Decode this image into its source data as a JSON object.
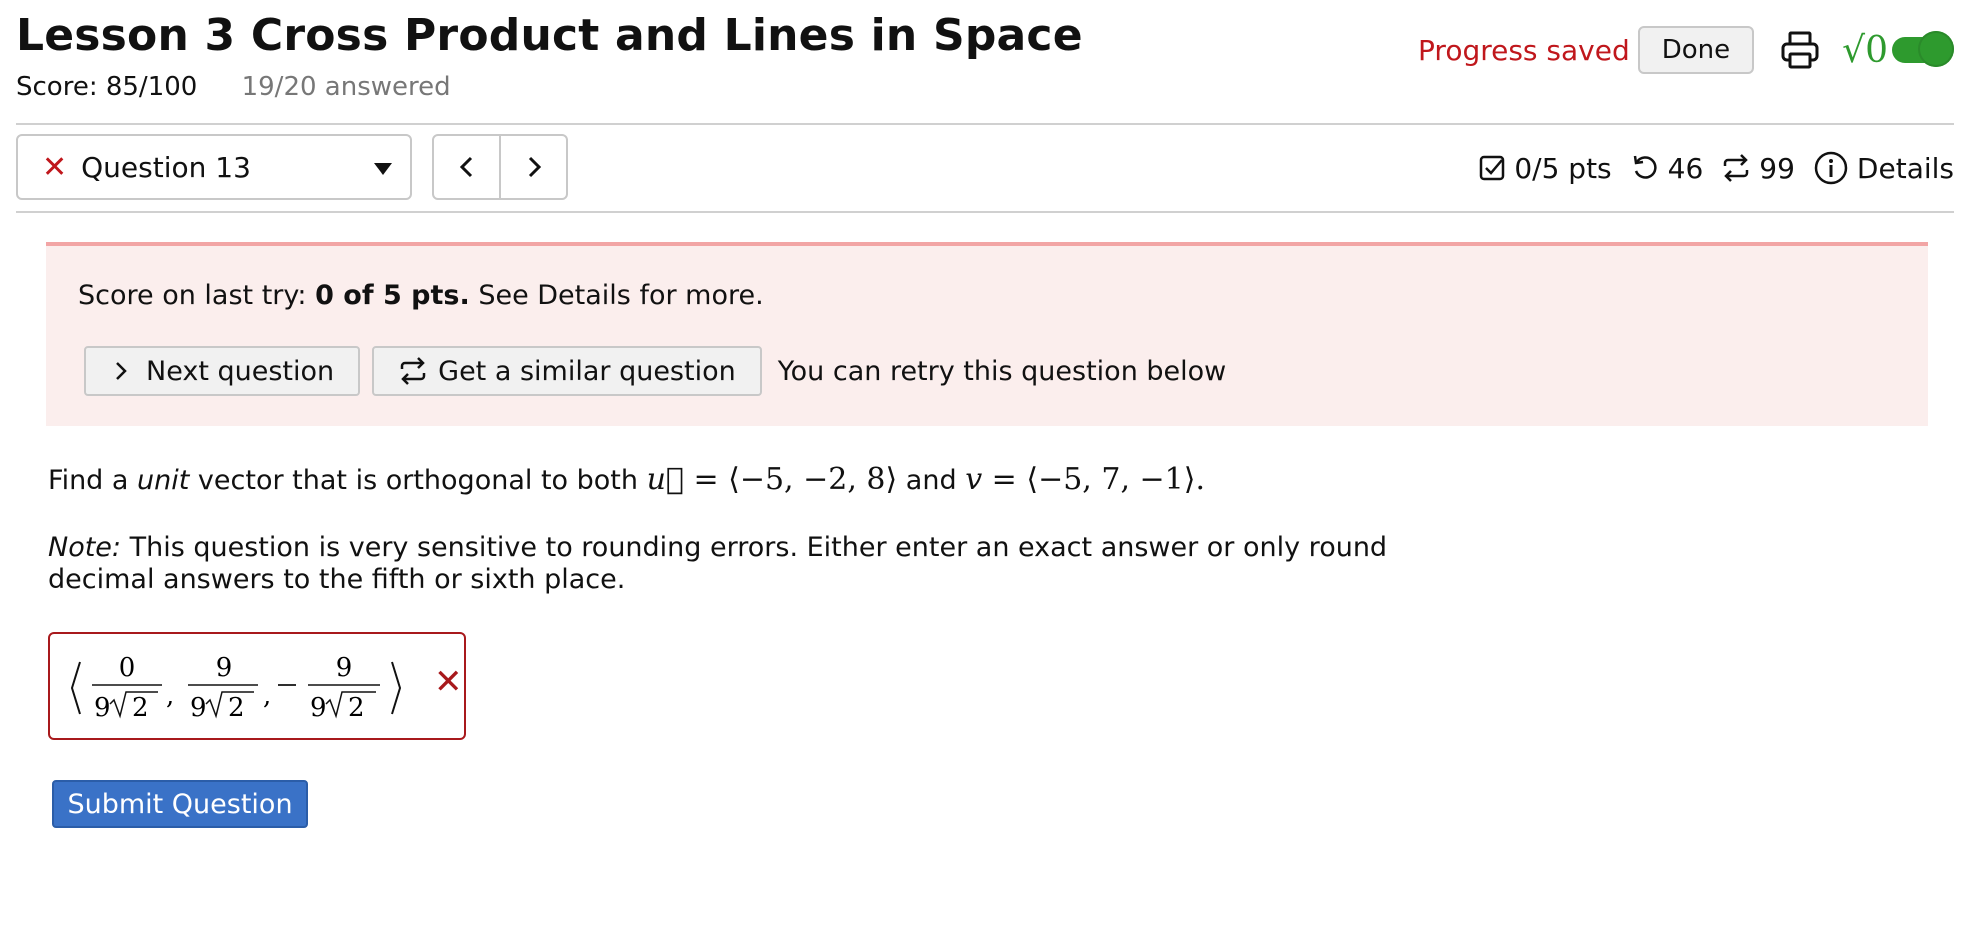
{
  "header": {
    "title": "Lesson 3 Cross Product and Lines in Space",
    "score": "Score: 85/100",
    "answered": "19/20 answered",
    "progress_saved": "Progress saved",
    "done_label": "Done"
  },
  "question_nav": {
    "current": "Question 13",
    "prev_glyph": "<",
    "next_glyph": ">"
  },
  "meta": {
    "points": "0/5 pts",
    "attempts": "46",
    "versions": "99",
    "details_label": "Details"
  },
  "alert": {
    "prefix": "Score on last try: ",
    "score": "0 of 5 pts.",
    "suffix": " See Details for more.",
    "next_label": "Next question",
    "similar_label": "Get a similar question",
    "retry_text": "You can retry this question below"
  },
  "question": {
    "text1": "Find a ",
    "text_em": "unit",
    "text2": " vector that is orthogonal to both ",
    "u_expr": "⟨−5, −2, 8⟩",
    "text3": " and ",
    "v_expr": "⟨−5, 7, −1⟩.",
    "note_label": "Note:",
    "note_text": " This question is very sensitive to rounding errors. Either enter an exact answer or only round decimal answers to the fifth or sixth place."
  },
  "answer": {
    "num1": "0",
    "num2": "9",
    "num3": "9",
    "den_coef": "9",
    "den_rad": "2",
    "status": "incorrect"
  },
  "submit_label": "Submit Question",
  "colors": {
    "error_red": "#c0171c",
    "toggle_green": "#2e9a2e",
    "submit_blue": "#3a72c7",
    "alert_bg": "#fbeeed"
  }
}
